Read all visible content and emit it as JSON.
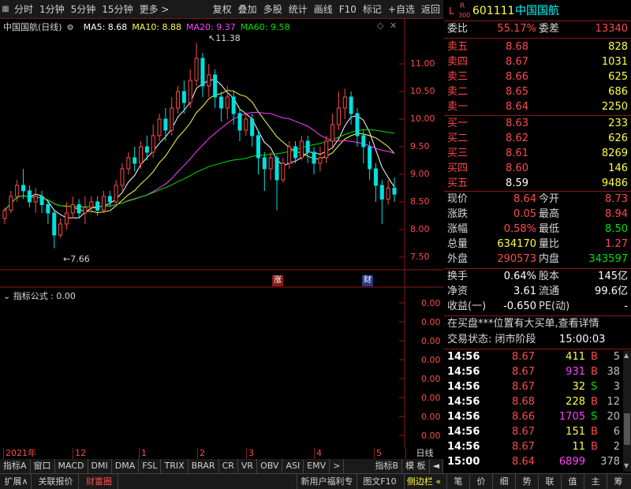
{
  "toolbar": {
    "items_left": [
      "分时",
      "1分钟",
      "5分钟",
      "15分钟",
      "更多 >"
    ],
    "items_right": [
      "复权",
      "叠加",
      "多股",
      "统计",
      "画线",
      "F10",
      "标记",
      "+自选",
      "返回"
    ]
  },
  "chart": {
    "title": "中国国航(日线)",
    "ma_labels": [
      {
        "text": "MA5: 8.68",
        "color": "#ffffff"
      },
      {
        "text": "MA10: 8.88",
        "color": "#ffff40"
      },
      {
        "text": "MA20: 9.37",
        "color": "#ff40ff"
      },
      {
        "text": "MA60: 9.58",
        "color": "#00e000"
      }
    ],
    "price_ticks": [
      "11.00",
      "10.50",
      "10.00",
      "9.50",
      "9.00",
      "8.50",
      "8.00",
      "7.50"
    ],
    "max_label": "11.38",
    "min_label": "7.66",
    "badge_zhang": "涨",
    "badge_cai": "财",
    "indicator_title": "指标公式 : 0.00",
    "indicator_ticks": [
      "0.00",
      "0.00",
      "0.00",
      "0.00",
      "0.00",
      "0.00",
      "0.00",
      "0.00"
    ],
    "x_labels": [
      "2021年",
      "12",
      "1",
      "2",
      "3",
      "4",
      "5"
    ],
    "period_button": "日线"
  },
  "chart_data": {
    "type": "candlestick",
    "title": "中国国航(日线)",
    "ylim": [
      7.3,
      11.7
    ],
    "ma_series": [
      {
        "name": "MA5",
        "value": 8.68,
        "color": "#ffffff"
      },
      {
        "name": "MA10",
        "value": 8.88,
        "color": "#ffff40"
      },
      {
        "name": "MA20",
        "value": 9.37,
        "color": "#ff40ff"
      },
      {
        "name": "MA60",
        "value": 9.58,
        "color": "#00e000"
      }
    ],
    "candles": [
      [
        8.2,
        8.35,
        8.1,
        8.4
      ],
      [
        8.35,
        8.6,
        8.3,
        8.7
      ],
      [
        8.6,
        8.8,
        8.5,
        8.9
      ],
      [
        8.8,
        8.7,
        8.55,
        9.1
      ],
      [
        8.7,
        8.5,
        8.4,
        8.8
      ],
      [
        8.5,
        8.6,
        8.3,
        8.75
      ],
      [
        8.6,
        8.45,
        8.3,
        8.7
      ],
      [
        8.45,
        8.3,
        8.1,
        8.5
      ],
      [
        8.3,
        7.9,
        7.66,
        8.35
      ],
      [
        7.9,
        8.1,
        7.85,
        8.2
      ],
      [
        8.1,
        8.3,
        8.0,
        8.5
      ],
      [
        8.3,
        8.45,
        8.2,
        8.6
      ],
      [
        8.45,
        8.3,
        8.2,
        8.55
      ],
      [
        8.3,
        8.4,
        8.1,
        8.6
      ],
      [
        8.4,
        8.5,
        8.3,
        8.6
      ],
      [
        8.5,
        8.35,
        8.25,
        8.6
      ],
      [
        8.35,
        8.6,
        8.3,
        8.7
      ],
      [
        8.6,
        8.5,
        8.4,
        8.7
      ],
      [
        8.5,
        8.8,
        8.45,
        8.9
      ],
      [
        8.8,
        9.1,
        8.7,
        9.2
      ],
      [
        9.1,
        9.3,
        9.0,
        9.4
      ],
      [
        9.3,
        9.2,
        9.05,
        9.5
      ],
      [
        9.2,
        9.5,
        9.1,
        9.6
      ],
      [
        9.5,
        9.4,
        9.25,
        9.7
      ],
      [
        9.4,
        9.7,
        9.3,
        9.9
      ],
      [
        9.7,
        10.0,
        9.6,
        10.1
      ],
      [
        10.0,
        9.8,
        9.6,
        10.2
      ],
      [
        9.8,
        10.2,
        9.7,
        10.4
      ],
      [
        10.2,
        10.5,
        10.1,
        10.6
      ],
      [
        10.5,
        10.3,
        10.1,
        10.7
      ],
      [
        10.3,
        10.7,
        10.2,
        10.9
      ],
      [
        10.7,
        11.1,
        10.6,
        11.38
      ],
      [
        11.1,
        10.6,
        10.4,
        11.2
      ],
      [
        10.6,
        10.8,
        10.4,
        11.0
      ],
      [
        10.8,
        10.4,
        10.2,
        10.9
      ],
      [
        10.4,
        10.2,
        9.95,
        10.5
      ],
      [
        10.2,
        10.4,
        10.0,
        10.6
      ],
      [
        10.4,
        10.1,
        9.9,
        10.5
      ],
      [
        10.1,
        9.8,
        9.6,
        10.2
      ],
      [
        9.8,
        10.0,
        9.7,
        10.1
      ],
      [
        10.0,
        9.7,
        9.5,
        10.1
      ],
      [
        9.7,
        9.3,
        9.0,
        9.8
      ],
      [
        9.3,
        9.1,
        8.7,
        9.4
      ],
      [
        9.1,
        9.3,
        8.9,
        9.4
      ],
      [
        9.3,
        8.9,
        8.35,
        9.35
      ],
      [
        8.9,
        9.2,
        8.85,
        9.3
      ],
      [
        9.2,
        9.5,
        9.1,
        9.6
      ],
      [
        9.5,
        9.3,
        9.2,
        9.6
      ],
      [
        9.3,
        9.6,
        9.25,
        9.7
      ],
      [
        9.6,
        9.4,
        9.2,
        9.7
      ],
      [
        9.4,
        9.2,
        9.0,
        9.5
      ],
      [
        9.2,
        9.3,
        9.05,
        9.5
      ],
      [
        9.3,
        9.6,
        9.2,
        9.7
      ],
      [
        9.6,
        9.9,
        9.5,
        10.1
      ],
      [
        9.9,
        10.2,
        9.8,
        10.5
      ],
      [
        10.2,
        10.4,
        10.0,
        10.55
      ],
      [
        10.4,
        10.1,
        9.9,
        10.5
      ],
      [
        10.1,
        9.7,
        9.5,
        10.2
      ],
      [
        9.7,
        9.5,
        9.2,
        9.8
      ],
      [
        9.5,
        9.1,
        8.9,
        9.6
      ],
      [
        9.1,
        8.8,
        8.5,
        9.2
      ],
      [
        8.8,
        8.55,
        8.1,
        8.9
      ],
      [
        8.55,
        8.75,
        8.45,
        8.9
      ],
      [
        8.75,
        8.64,
        8.5,
        8.94
      ]
    ]
  },
  "quote": {
    "code": "601111",
    "name": "中国国航",
    "badge_l": "L",
    "badge_r": "R",
    "badge_num": "300",
    "weibi_label": "委比",
    "weibi": "55.17%",
    "weicha_label": "委差",
    "weicha": "13340",
    "asks": [
      {
        "label": "卖五",
        "price": "8.68",
        "vol": "828"
      },
      {
        "label": "卖四",
        "price": "8.67",
        "vol": "1031"
      },
      {
        "label": "卖三",
        "price": "8.66",
        "vol": "625"
      },
      {
        "label": "卖二",
        "price": "8.65",
        "vol": "686"
      },
      {
        "label": "卖一",
        "price": "8.64",
        "vol": "2250"
      }
    ],
    "bids": [
      {
        "label": "买一",
        "price": "8.63",
        "vol": "233",
        "pcolor": "red"
      },
      {
        "label": "买二",
        "price": "8.62",
        "vol": "626",
        "pcolor": "red"
      },
      {
        "label": "买三",
        "price": "8.61",
        "vol": "8269",
        "pcolor": "red"
      },
      {
        "label": "买四",
        "price": "8.60",
        "vol": "146",
        "pcolor": "red"
      },
      {
        "label": "买五",
        "price": "8.59",
        "vol": "9486",
        "pcolor": "white"
      }
    ],
    "stats": [
      {
        "l1": "现价",
        "v1": "8.64",
        "c1": "red",
        "l2": "今开",
        "v2": "8.73",
        "c2": "red"
      },
      {
        "l1": "涨跌",
        "v1": "0.05",
        "c1": "red",
        "l2": "最高",
        "v2": "8.94",
        "c2": "red"
      },
      {
        "l1": "涨幅",
        "v1": "0.58%",
        "c1": "red",
        "l2": "最低",
        "v2": "8.50",
        "c2": "green"
      },
      {
        "l1": "总量",
        "v1": "634170",
        "c1": "yellow",
        "l2": "量比",
        "v2": "1.27",
        "c2": "red"
      },
      {
        "l1": "外盘",
        "v1": "290573",
        "c1": "red",
        "l2": "内盘",
        "v2": "343597",
        "c2": "green"
      }
    ],
    "fund": [
      {
        "l1": "换手",
        "v1": "0.64%",
        "l2": "股本",
        "v2": "145亿"
      },
      {
        "l1": "净资",
        "v1": "3.61",
        "l2": "流通",
        "v2": "99.6亿"
      },
      {
        "l1": "收益(一)",
        "v1": "-0.650",
        "l2": "PE(动)",
        "v2": "-"
      }
    ],
    "notice": "在买盘***位置有大买单,查看详情",
    "trade_status_label": "交易状态: 闭市阶段",
    "trade_status_time": "15:00:03",
    "ticks": [
      {
        "t": "14:56",
        "p": "8.67",
        "v": "411",
        "vc": "yellow",
        "d": "B",
        "dc": "red",
        "n": "5"
      },
      {
        "t": "14:56",
        "p": "8.67",
        "v": "931",
        "vc": "mag",
        "d": "B",
        "dc": "red",
        "n": "38"
      },
      {
        "t": "14:56",
        "p": "8.67",
        "v": "32",
        "vc": "yellow",
        "d": "S",
        "dc": "green",
        "n": "3"
      },
      {
        "t": "14:56",
        "p": "8.68",
        "v": "228",
        "vc": "yellow",
        "d": "B",
        "dc": "red",
        "n": "12"
      },
      {
        "t": "14:56",
        "p": "8.66",
        "v": "1705",
        "vc": "mag",
        "d": "S",
        "dc": "green",
        "n": "20"
      },
      {
        "t": "14:56",
        "p": "8.67",
        "v": "151",
        "vc": "yellow",
        "d": "B",
        "dc": "red",
        "n": "6"
      },
      {
        "t": "14:56",
        "p": "8.67",
        "v": "11",
        "vc": "yellow",
        "d": "B",
        "dc": "red",
        "n": "2"
      },
      {
        "t": "15:00",
        "p": "8.64",
        "v": "6899",
        "vc": "mag",
        "d": "",
        "dc": "red",
        "n": "378"
      }
    ]
  },
  "tabs": [
    "指标A",
    "窗口",
    "MACD",
    "DMI",
    "DMA",
    "FSL",
    "TRIX",
    "BRAR",
    "CR",
    "VR",
    "OBV",
    "ASI",
    "EMV",
    ">",
    "指标B",
    "模 板",
    "◄"
  ],
  "statusbar": {
    "left": [
      "扩展∧",
      "关联报价",
      "财富圈"
    ],
    "mid": [
      "新用户福利专享",
      "图文F10",
      "侧边栏 «"
    ],
    "right": [
      "笔",
      "价",
      "细",
      "势",
      "联",
      "值",
      "主",
      "筹"
    ]
  }
}
